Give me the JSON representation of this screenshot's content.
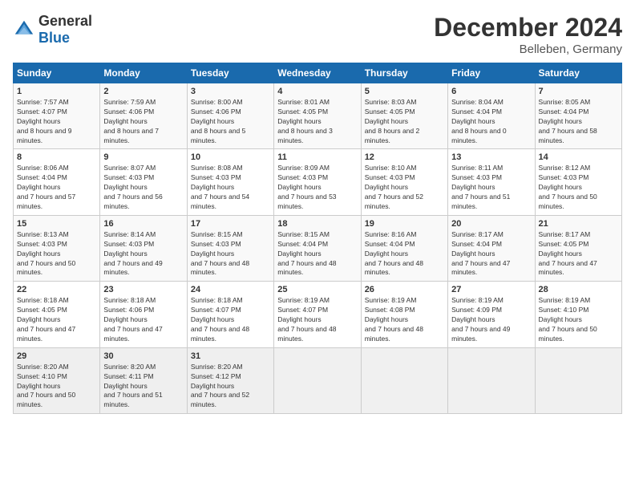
{
  "header": {
    "logo_general": "General",
    "logo_blue": "Blue",
    "title": "December 2024",
    "subtitle": "Belleben, Germany"
  },
  "days_of_week": [
    "Sunday",
    "Monday",
    "Tuesday",
    "Wednesday",
    "Thursday",
    "Friday",
    "Saturday"
  ],
  "weeks": [
    [
      {
        "day": "1",
        "sunrise": "7:57 AM",
        "sunset": "4:07 PM",
        "daylight": "8 hours and 9 minutes."
      },
      {
        "day": "2",
        "sunrise": "7:59 AM",
        "sunset": "4:06 PM",
        "daylight": "8 hours and 7 minutes."
      },
      {
        "day": "3",
        "sunrise": "8:00 AM",
        "sunset": "4:06 PM",
        "daylight": "8 hours and 5 minutes."
      },
      {
        "day": "4",
        "sunrise": "8:01 AM",
        "sunset": "4:05 PM",
        "daylight": "8 hours and 3 minutes."
      },
      {
        "day": "5",
        "sunrise": "8:03 AM",
        "sunset": "4:05 PM",
        "daylight": "8 hours and 2 minutes."
      },
      {
        "day": "6",
        "sunrise": "8:04 AM",
        "sunset": "4:04 PM",
        "daylight": "8 hours and 0 minutes."
      },
      {
        "day": "7",
        "sunrise": "8:05 AM",
        "sunset": "4:04 PM",
        "daylight": "7 hours and 58 minutes."
      }
    ],
    [
      {
        "day": "8",
        "sunrise": "8:06 AM",
        "sunset": "4:04 PM",
        "daylight": "7 hours and 57 minutes."
      },
      {
        "day": "9",
        "sunrise": "8:07 AM",
        "sunset": "4:03 PM",
        "daylight": "7 hours and 56 minutes."
      },
      {
        "day": "10",
        "sunrise": "8:08 AM",
        "sunset": "4:03 PM",
        "daylight": "7 hours and 54 minutes."
      },
      {
        "day": "11",
        "sunrise": "8:09 AM",
        "sunset": "4:03 PM",
        "daylight": "7 hours and 53 minutes."
      },
      {
        "day": "12",
        "sunrise": "8:10 AM",
        "sunset": "4:03 PM",
        "daylight": "7 hours and 52 minutes."
      },
      {
        "day": "13",
        "sunrise": "8:11 AM",
        "sunset": "4:03 PM",
        "daylight": "7 hours and 51 minutes."
      },
      {
        "day": "14",
        "sunrise": "8:12 AM",
        "sunset": "4:03 PM",
        "daylight": "7 hours and 50 minutes."
      }
    ],
    [
      {
        "day": "15",
        "sunrise": "8:13 AM",
        "sunset": "4:03 PM",
        "daylight": "7 hours and 50 minutes."
      },
      {
        "day": "16",
        "sunrise": "8:14 AM",
        "sunset": "4:03 PM",
        "daylight": "7 hours and 49 minutes."
      },
      {
        "day": "17",
        "sunrise": "8:15 AM",
        "sunset": "4:03 PM",
        "daylight": "7 hours and 48 minutes."
      },
      {
        "day": "18",
        "sunrise": "8:15 AM",
        "sunset": "4:04 PM",
        "daylight": "7 hours and 48 minutes."
      },
      {
        "day": "19",
        "sunrise": "8:16 AM",
        "sunset": "4:04 PM",
        "daylight": "7 hours and 48 minutes."
      },
      {
        "day": "20",
        "sunrise": "8:17 AM",
        "sunset": "4:04 PM",
        "daylight": "7 hours and 47 minutes."
      },
      {
        "day": "21",
        "sunrise": "8:17 AM",
        "sunset": "4:05 PM",
        "daylight": "7 hours and 47 minutes."
      }
    ],
    [
      {
        "day": "22",
        "sunrise": "8:18 AM",
        "sunset": "4:05 PM",
        "daylight": "7 hours and 47 minutes."
      },
      {
        "day": "23",
        "sunrise": "8:18 AM",
        "sunset": "4:06 PM",
        "daylight": "7 hours and 47 minutes."
      },
      {
        "day": "24",
        "sunrise": "8:18 AM",
        "sunset": "4:07 PM",
        "daylight": "7 hours and 48 minutes."
      },
      {
        "day": "25",
        "sunrise": "8:19 AM",
        "sunset": "4:07 PM",
        "daylight": "7 hours and 48 minutes."
      },
      {
        "day": "26",
        "sunrise": "8:19 AM",
        "sunset": "4:08 PM",
        "daylight": "7 hours and 48 minutes."
      },
      {
        "day": "27",
        "sunrise": "8:19 AM",
        "sunset": "4:09 PM",
        "daylight": "7 hours and 49 minutes."
      },
      {
        "day": "28",
        "sunrise": "8:19 AM",
        "sunset": "4:10 PM",
        "daylight": "7 hours and 50 minutes."
      }
    ],
    [
      {
        "day": "29",
        "sunrise": "8:20 AM",
        "sunset": "4:10 PM",
        "daylight": "7 hours and 50 minutes."
      },
      {
        "day": "30",
        "sunrise": "8:20 AM",
        "sunset": "4:11 PM",
        "daylight": "7 hours and 51 minutes."
      },
      {
        "day": "31",
        "sunrise": "8:20 AM",
        "sunset": "4:12 PM",
        "daylight": "7 hours and 52 minutes."
      },
      null,
      null,
      null,
      null
    ]
  ]
}
